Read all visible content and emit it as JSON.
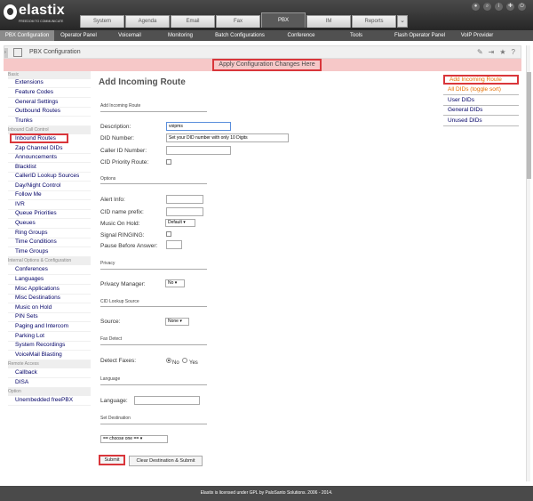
{
  "brand": {
    "name": "elastix",
    "tagline": "FREEDOM TO COMMUNICATE"
  },
  "top_tabs": [
    "System",
    "Agenda",
    "Email",
    "Fax",
    "PBX",
    "IM",
    "Reports"
  ],
  "top_tab_active": "PBX",
  "tool_icons": [
    "user-icon",
    "search-icon",
    "info-icon",
    "pin-icon",
    "logout-icon"
  ],
  "menu": [
    "PBX Configuration",
    "Operator Panel",
    "Voicemail",
    "Monitoring",
    "Batch Configurations",
    "Conference",
    "Tools",
    "Flash Operator Panel",
    "VoIP Provider"
  ],
  "page_title": "PBX Configuration",
  "alert": "Apply Configuration Changes Here",
  "sidebar": {
    "sections": [
      "Basic",
      "Inbound Call Control",
      "Internal Options & Configuration",
      "Remote Access",
      "Option"
    ],
    "items": [
      "Extensions",
      "Feature Codes",
      "General Settings",
      "Outbound Routes",
      "Trunks",
      "Inbound Routes",
      "Zap Channel DIDs",
      "Announcements",
      "Blacklist",
      "CallerID Lookup Sources",
      "Day/Night Control",
      "Follow Me",
      "IVR",
      "Queue Priorities",
      "Queues",
      "Ring Groups",
      "Time Conditions",
      "Time Groups",
      "Conferences",
      "Languages",
      "Misc Applications",
      "Misc Destinations",
      "Music on Hold",
      "PIN Sets",
      "Paging and Intercom",
      "Parking Lot",
      "System Recordings",
      "VoiceMail Blasting",
      "Callback",
      "DISA",
      "Unembedded freePBX"
    ]
  },
  "form": {
    "title": "Add Incoming Route",
    "sections": {
      "incoming": "Add Incoming Route",
      "options": "Options",
      "privacy": "Privacy",
      "cid_lookup": "CID Lookup Source",
      "fax": "Fax Detect",
      "language": "Language",
      "destination": "Set Destination"
    },
    "labels": {
      "description": "Description:",
      "did": "DID Number:",
      "caller_id": "Caller ID Number:",
      "cid_priority": "CID Priority Route:",
      "alert_info": "Alert Info:",
      "cid_prefix": "CID name prefix:",
      "moh": "Music On Hold:",
      "ringing": "Signal RINGING:",
      "pause": "Pause Before Answer:",
      "privacy_manager": "Privacy Manager:",
      "source": "Source:",
      "detect_faxes": "Detect Faxes:",
      "language": "Language:"
    },
    "values": {
      "description": "voipms",
      "did": "Set your DID number with only 10 Digits",
      "moh": "Default",
      "privacy": "No",
      "source": "None",
      "destination": "== choose one =="
    },
    "radio": {
      "no": "No",
      "yes": "Yes"
    },
    "buttons": {
      "submit": "Submit",
      "clear": "Clear Destination & Submit"
    }
  },
  "right_menu": [
    "Add Incoming Route",
    "All DIDs (toggle sort)",
    "User DIDs",
    "General DIDs",
    "Unused DIDs"
  ],
  "footer": "Elastix is licensed under GPL by PaloSanto Solutions. 2006 - 2014.",
  "colors": {
    "highlight": "#d9363b",
    "header_dark": "#4a4a4a",
    "alert_bg": "#f6c8c8",
    "link": "#006"
  }
}
